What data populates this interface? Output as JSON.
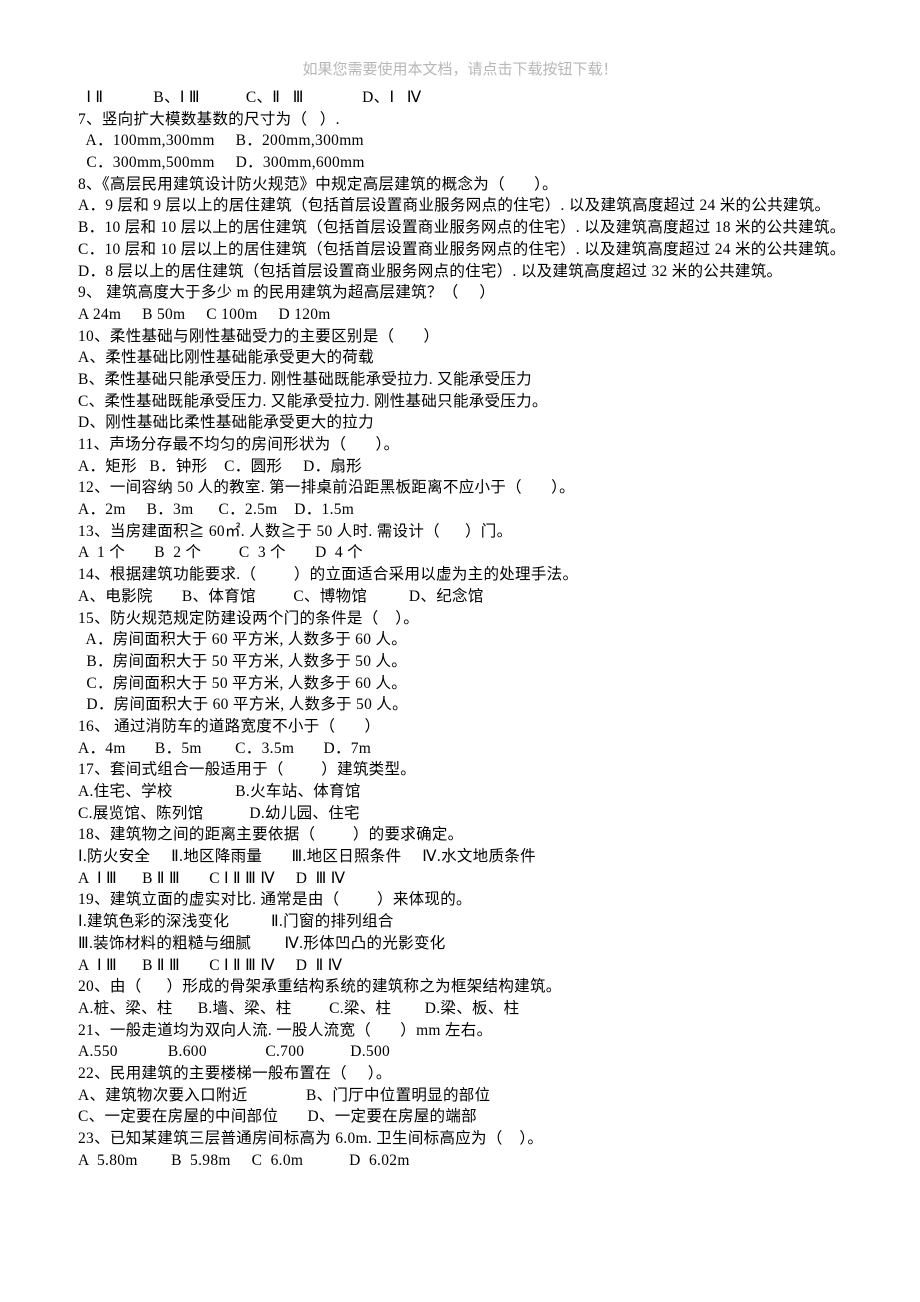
{
  "header": "如果您需要使用本文档，请点击下载按钮下载！",
  "lines": [
    "  Ⅰ Ⅱ            B、Ⅰ Ⅲ           C、Ⅱ   Ⅲ              D、Ⅰ   Ⅳ",
    "7、竖向扩大模数基数的尺寸为（   ）.",
    "  A．100mm,300mm     B．200mm,300mm",
    "  C．300mm,500mm     D．300mm,600mm",
    "8、《高层民用建筑设计防火规范》中规定高层建筑的概念为（       ）。",
    "A．9 层和 9 层以上的居住建筑（包括首层设置商业服务网点的住宅）. 以及建筑高度超过 24 米的公共建筑。",
    "B．10 层和 10 层以上的居住建筑（包括首层设置商业服务网点的住宅）. 以及建筑高度超过 18 米的公共建筑。",
    "C．10 层和 10 层以上的居住建筑（包括首层设置商业服务网点的住宅）. 以及建筑高度超过 24 米的公共建筑。",
    "D．8 层以上的居住建筑（包括首层设置商业服务网点的住宅）. 以及建筑高度超过 32 米的公共建筑。",
    "9、 建筑高度大于多少 m 的民用建筑为超高层建筑？（     ）",
    "A 24m     B 50m     C 100m     D 120m",
    "10、柔性基础与刚性基础受力的主要区别是（       ）",
    "A、柔性基础比刚性基础能承受更大的荷载",
    "B、柔性基础只能承受压力. 刚性基础既能承受拉力. 又能承受压力",
    "C、柔性基础既能承受压力. 又能承受拉力. 刚性基础只能承受压力。",
    "D、刚性基础比柔性基础能承受更大的拉力",
    "11、声场分存最不均匀的房间形状为（       ）。",
    "A．矩形   B．钟形    C．圆形     D．扇形",
    "12、一间容纳 50 人的教室. 第一排桌前沿距黑板距离不应小于（       ）。",
    "A．2m     B．3m      C．2.5m    D．1.5m",
    "13、当房建面积≧ 60㎡. 人数≧于 50 人时. 需设计（      ）门。",
    "A  1 个       B  2 个         C  3 个       D  4 个",
    "14、根据建筑功能要求.（         ）的立面适合采用以虚为主的处理手法。",
    "A、电影院       B、体育馆         C、博物馆          D、纪念馆",
    "15、防火规范规定防建设两个门的条件是（    ）。",
    "  A．房间面积大于 60 平方米, 人数多于 60 人。",
    "  B．房间面积大于 50 平方米, 人数多于 50 人。",
    "  C．房间面积大于 50 平方米, 人数多于 60 人。",
    "  D．房间面积大于 60 平方米, 人数多于 50 人。",
    "16、 通过消防车的道路宽度不小于（       ）",
    "A．4m       B．5m        C．3.5m       D．7m",
    "17、套间式组合一般适用于（         ）建筑类型。",
    "A.住宅、学校               B.火车站、体育馆",
    "C.展览馆、陈列馆           D.幼儿园、住宅",
    "18、建筑物之间的距离主要依据（         ）的要求确定。",
    "Ⅰ.防火安全     Ⅱ.地区降雨量       Ⅲ.地区日照条件     Ⅳ.水文地质条件",
    "A  Ⅰ Ⅲ      B Ⅱ Ⅲ       C Ⅰ Ⅱ Ⅲ Ⅳ     D  Ⅲ Ⅳ",
    "19、建筑立面的虚实对比. 通常是由（         ）来体现的。",
    "Ⅰ.建筑色彩的深浅变化          Ⅱ.门窗的排列组合",
    "Ⅲ.装饰材料的粗糙与细腻        Ⅳ.形体凹凸的光影变化",
    "A  Ⅰ Ⅲ      B Ⅱ Ⅲ       C Ⅰ Ⅱ Ⅲ Ⅳ     D  Ⅱ Ⅳ",
    "20、由（      ）形成的骨架承重结构系统的建筑称之为框架结构建筑。",
    "A.桩、梁、柱      B.墙、梁、柱         C.梁、柱        D.梁、板、柱",
    "21、一般走道均为双向人流. 一股人流宽（       ）mm 左右。",
    "A.550            B.600              C.700           D.500",
    "22、民用建筑的主要楼梯一般布置在（     ）。",
    "A、建筑物次要入口附近              B、门厅中位置明显的部位",
    "C、一定要在房屋的中间部位       D、一定要在房屋的端部",
    "23、已知某建筑三层普通房间标高为 6.0m. 卫生间标高应为（    ）。",
    "A  5.80m        B  5.98m     C  6.0m           D  6.02m"
  ]
}
